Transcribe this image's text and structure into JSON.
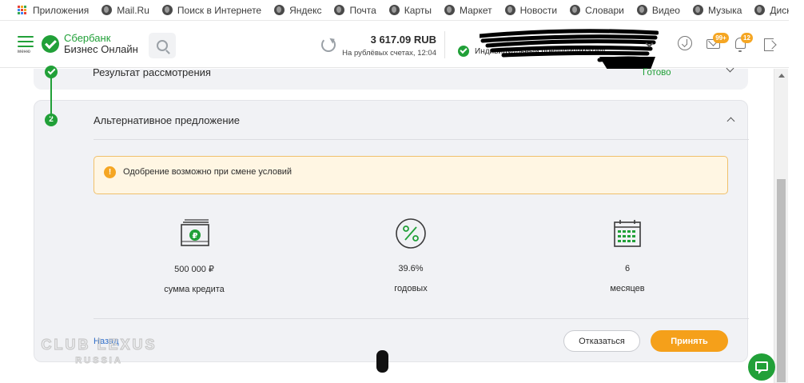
{
  "bookmarks": {
    "items": [
      {
        "label": "Приложения",
        "icon": "apps-grid-icon"
      },
      {
        "label": "Mail.Ru",
        "icon": "globe-icon"
      },
      {
        "label": "Поиск в Интернете",
        "icon": "globe-icon"
      },
      {
        "label": "Яндекс",
        "icon": "globe-icon"
      },
      {
        "label": "Почта",
        "icon": "globe-icon"
      },
      {
        "label": "Карты",
        "icon": "globe-icon"
      },
      {
        "label": "Маркет",
        "icon": "globe-icon"
      },
      {
        "label": "Новости",
        "icon": "globe-icon"
      },
      {
        "label": "Словари",
        "icon": "globe-icon"
      },
      {
        "label": "Видео",
        "icon": "globe-icon"
      },
      {
        "label": "Музыка",
        "icon": "globe-icon"
      },
      {
        "label": "Диск",
        "icon": "globe-icon"
      }
    ],
    "more": "»"
  },
  "header": {
    "menu_caption": "меню",
    "logo_line1": "Сбербанк",
    "logo_line2": "Бизнес Онлайн",
    "balance_amount": "3 617.09 RUB",
    "balance_sub": "На рублёвых счетах, 12:04",
    "org_type": "Индивидуальный предприниматель",
    "mail_badge": "99+",
    "bell_badge": "12"
  },
  "steps": {
    "review": {
      "title": "Результат рассмотрения",
      "status": "Готово"
    },
    "alternative": {
      "number": "2",
      "title": "Альтернативное предложение",
      "warning": "Одобрение возможно при смене условий",
      "warning_icon_glyph": "!",
      "params": [
        {
          "icon": "cash-icon",
          "value": "500 000 ₽",
          "label": "сумма кредита"
        },
        {
          "icon": "percent-icon",
          "value": "39.6%",
          "label": "годовых"
        },
        {
          "icon": "calendar-icon",
          "value": "6",
          "label": "месяцев"
        }
      ],
      "back_label": "Назад",
      "decline_label": "Отказаться",
      "accept_label": "Принять"
    }
  },
  "watermark": {
    "line1": "CLUB LEXUS",
    "line2": "RUSSIA"
  },
  "colors": {
    "brand_green": "#21a038",
    "accent_orange": "#f5a01a",
    "warning_bg": "#fff6e3",
    "warning_border": "#f0c06b",
    "card_bg": "#f1f2f5",
    "link_blue": "#2f6ec9"
  }
}
